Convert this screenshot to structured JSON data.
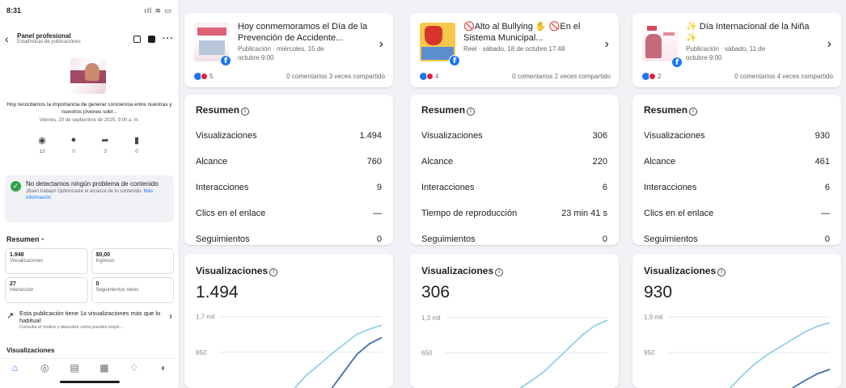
{
  "phone": {
    "status": {
      "time": "8:31",
      "signal": "ıll ≋ ▭"
    },
    "header": {
      "title": "Panel profesional",
      "subtitle": "Estadísticas de publicaciones"
    },
    "caption": "Hoy recordamos la importancia de generar conciencia entre nuestras y nuestros jóvenes sobr...",
    "date": "Viernes, 20 de septiembre de 2025, 9:00 a. m.",
    "stats": [
      {
        "icon": "eye-icon",
        "glyph": "◉",
        "value": "13"
      },
      {
        "icon": "comment-icon",
        "glyph": "●",
        "value": "0"
      },
      {
        "icon": "share-icon",
        "glyph": "➦",
        "value": "3"
      },
      {
        "icon": "bookmark-icon",
        "glyph": "▮",
        "value": "0"
      }
    ],
    "notice": {
      "title": "No detectamos ningún problema de contenido",
      "body": "¡Buen trabajo! Optimizaste el alcance de tu contenido.",
      "link": "Más información"
    },
    "summary_title": "Resumen",
    "summary": [
      {
        "value": "1.948",
        "label": "Visualizaciones"
      },
      {
        "value": "$0,00",
        "label": "Ingresos"
      },
      {
        "value": "27",
        "label": "Interacción"
      },
      {
        "value": "0",
        "label": "Seguimientos netos"
      }
    ],
    "trend": {
      "title": "Esta publicación tiene 1x visualizaciones más que lo habitual",
      "sub": "Consulta el motivo y descubre cómo puedes mejor..."
    },
    "vis_peek": "Visualizaciones",
    "nav": [
      {
        "name": "nav-home-icon",
        "glyph": "⌂",
        "active": true
      },
      {
        "name": "nav-earnings-icon",
        "glyph": "◎",
        "active": false
      },
      {
        "name": "nav-content-icon",
        "glyph": "▤",
        "active": false
      },
      {
        "name": "nav-insights-icon",
        "glyph": "▦",
        "active": false
      },
      {
        "name": "nav-notifications-icon",
        "glyph": "♢",
        "active": false,
        "badge": true
      },
      {
        "name": "nav-profile-icon",
        "glyph": "◐",
        "active": false
      }
    ]
  },
  "columns": [
    {
      "post": {
        "title": "Hoy conmemoramos el Día de la Prevención de Accidente...",
        "meta1": "Publicación · miércoles, 15 de",
        "meta2": "octubre 9:00",
        "reactions": "5",
        "comments": "0 comentarios",
        "shares": "3 veces compartido"
      },
      "summary_title": "Resumen",
      "metrics": [
        {
          "label": "Visualizaciones",
          "value": "1.494"
        },
        {
          "label": "Alcance",
          "value": "760"
        },
        {
          "label": "Interacciones",
          "value": "9"
        },
        {
          "label": "Clics en el enlace",
          "value": "—"
        },
        {
          "label": "Seguimientos",
          "value": "0"
        }
      ],
      "vis_title": "Visualizaciones",
      "vis_value": "1.494",
      "chart_data": {
        "type": "line",
        "ticks": [
          {
            "label": "1,7 mil",
            "value": 1700
          },
          {
            "label": "850",
            "value": 850
          }
        ],
        "ylim": [
          0,
          2000
        ],
        "series": [
          {
            "color": "#8fd0e8",
            "values": [
              0,
              0,
              0,
              0,
              0,
              0,
              0,
              320,
              560,
              820,
              1050,
              1280,
              1400,
              1494
            ]
          },
          {
            "color": "#3b6fa8",
            "values": [
              0,
              0,
              0,
              0,
              0,
              0,
              0,
              0,
              0,
              0,
              400,
              800,
              1050,
              1200
            ]
          }
        ]
      }
    },
    {
      "post": {
        "title": "🚫Alto al Bullying ✋ 🚫En el Sistema Municipal...",
        "meta1": "Reel · sábado, 18 de octubre 17:48",
        "meta2": "",
        "reactions": "4",
        "comments": "0 comentarios",
        "shares": "2 veces compartido"
      },
      "summary_title": "Resumen",
      "metrics": [
        {
          "label": "Visualizaciones",
          "value": "306"
        },
        {
          "label": "Alcance",
          "value": "220"
        },
        {
          "label": "Interacciones",
          "value": "6"
        },
        {
          "label": "Tiempo de reproducción",
          "value": "23 min 41 s"
        },
        {
          "label": "Seguimientos",
          "value": "0"
        }
      ],
      "vis_title": "Visualizaciones",
      "vis_value": "306",
      "chart_data": {
        "type": "line",
        "ticks": [
          {
            "label": "1,3 mil",
            "value": 1300
          },
          {
            "label": "650",
            "value": 650
          }
        ],
        "ylim": [
          0,
          1550
        ],
        "series": [
          {
            "color": "#8fd0e8",
            "values": [
              0,
              0,
              0,
              0,
              0,
              0,
              0,
              150,
              320,
              540,
              760,
              980,
              1150,
              1250
            ]
          }
        ]
      }
    },
    {
      "post": {
        "title": "✨ Día Internacional de la Niña ✨",
        "meta1": "Publicación · sábado, 11 de",
        "meta2": "octubre 9:00",
        "reactions": "2",
        "comments": "0 comentarios",
        "shares": "4 veces compartido"
      },
      "summary_title": "Resumen",
      "metrics": [
        {
          "label": "Visualizaciones",
          "value": "930"
        },
        {
          "label": "Alcance",
          "value": "461"
        },
        {
          "label": "Interacciones",
          "value": "6"
        },
        {
          "label": "Clics en el enlace",
          "value": "—"
        },
        {
          "label": "Seguimientos",
          "value": "0"
        }
      ],
      "vis_title": "Visualizaciones",
      "vis_value": "930",
      "chart_data": {
        "type": "line",
        "ticks": [
          {
            "label": "1,9 mil",
            "value": 1900
          },
          {
            "label": "950",
            "value": 950
          }
        ],
        "ylim": [
          0,
          2250
        ],
        "series": [
          {
            "color": "#8fd0e8",
            "values": [
              0,
              0,
              0,
              0,
              0,
              0,
              350,
              650,
              900,
              1100,
              1300,
              1500,
              1650,
              1750
            ]
          },
          {
            "color": "#3b6fa8",
            "values": [
              0,
              0,
              0,
              0,
              0,
              0,
              0,
              0,
              0,
              0,
              0,
              200,
              380,
              500
            ]
          }
        ]
      }
    }
  ]
}
